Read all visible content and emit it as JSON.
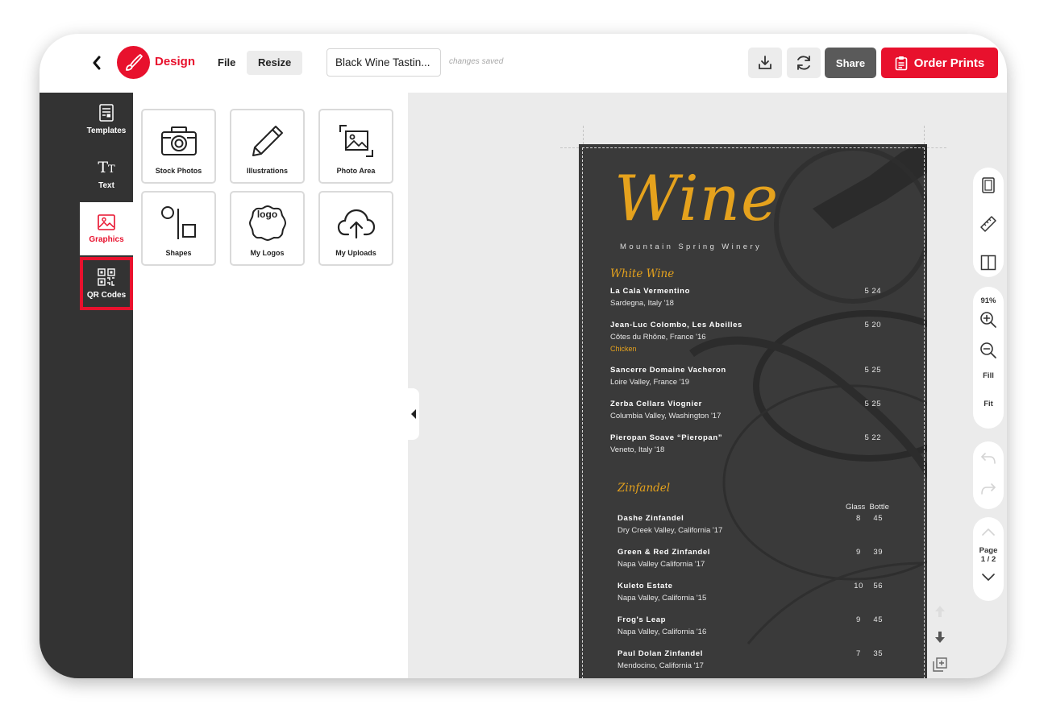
{
  "header": {
    "app_name": "Design",
    "menu_file": "File",
    "menu_resize": "Resize",
    "document_title": "Black Wine Tastin...",
    "save_status": "changes saved",
    "share_label": "Share",
    "order_prints_label": "Order Prints"
  },
  "sidebar": {
    "items": [
      {
        "label": "Templates",
        "icon": "templates-icon"
      },
      {
        "label": "Text",
        "icon": "text-icon"
      },
      {
        "label": "Graphics",
        "icon": "graphics-icon"
      },
      {
        "label": "QR Codes",
        "icon": "qr-code-icon"
      }
    ]
  },
  "graphics_panel": {
    "tiles": [
      {
        "label": "Stock Photos",
        "icon": "camera-icon"
      },
      {
        "label": "Illustrations",
        "icon": "pencil-icon"
      },
      {
        "label": "Photo Area",
        "icon": "photo-area-icon"
      },
      {
        "label": "Shapes",
        "icon": "shapes-icon"
      },
      {
        "label": "My Logos",
        "icon": "logo-icon"
      },
      {
        "label": "My Uploads",
        "icon": "upload-cloud-icon"
      }
    ],
    "logo_text": "logo"
  },
  "menu_document": {
    "title": "Wine",
    "subtitle": "Mountain Spring Winery",
    "sections": [
      {
        "heading": "White Wine",
        "items": [
          {
            "name": "La Cala Vermentino",
            "origin": "Sardegna, Italy '18",
            "price": "5  24"
          },
          {
            "name": "Jean-Luc Colombo, Les Abeilles",
            "origin": "Côtes du Rhône, France '16",
            "note": "Chicken",
            "price": "5  20"
          },
          {
            "name": "Sancerre Domaine Vacheron",
            "origin": "Loire Valley, France '19",
            "price": "5  25"
          },
          {
            "name": "Zerba Cellars Viognier",
            "origin": "Columbia Valley, Washington '17",
            "price": "5  25"
          },
          {
            "name": "Pieropan Soave “Pieropan”",
            "origin": "Veneto, Italy '18",
            "price": "5  22"
          }
        ]
      },
      {
        "heading": "Zinfandel",
        "column_header": "Glass  Bottle",
        "items": [
          {
            "name": "Dashe Zinfandel",
            "origin": "Dry Creek Valley, California '17",
            "price": "8     45"
          },
          {
            "name": "Green & Red Zinfandel",
            "origin": "Napa Valley California '17",
            "price": "9     39"
          },
          {
            "name": "Kuleto Estate",
            "origin": "Napa Valley, California '15",
            "price": "10    56"
          },
          {
            "name": "Frog's Leap",
            "origin": "Napa Valley, California '16",
            "price": "9     45"
          },
          {
            "name": "Paul Dolan Zinfandel",
            "origin": "Mendocino, California '17",
            "price": "7     35"
          }
        ]
      }
    ]
  },
  "right_toolbar": {
    "zoom": "91%",
    "fill_label": "Fill",
    "fit_label": "Fit",
    "page_label": "Page",
    "page_number": "1 / 2"
  },
  "colors": {
    "brand_red": "#e8112d",
    "menu_gold": "#e5a21d",
    "menu_background": "#3a3a3a",
    "sidebar_dark": "#333333"
  }
}
